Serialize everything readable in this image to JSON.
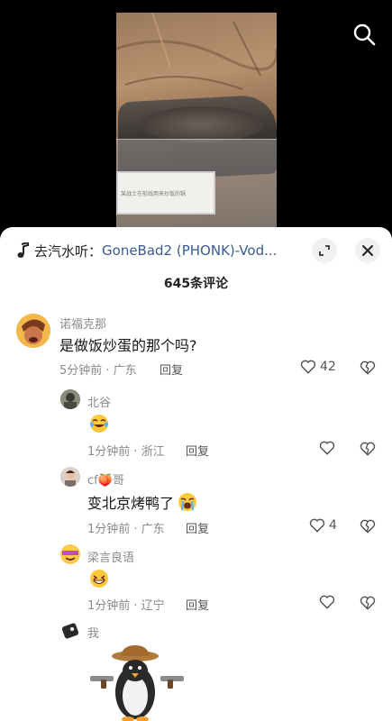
{
  "sheet": {
    "music_prefix": "去汽水听：",
    "music_title": "GoneBad2 (PHONK)-Vod...",
    "comment_count": "645条评论"
  },
  "placard_text": "某战士在前线用来炒饭的锅",
  "comments": [
    {
      "username": "诺福克那",
      "text": "是做饭炒蛋的那个吗?",
      "meta": "5分钟前 · 广东",
      "reply_label": "回复",
      "likes": "42"
    },
    {
      "username": "北谷",
      "text": "",
      "meta": "1分钟前 · 浙江",
      "reply_label": "回复",
      "likes": ""
    },
    {
      "username": "cf🍑哥",
      "text": "变北京烤鸭了",
      "meta": "1分钟前 · 广东",
      "reply_label": "回复",
      "likes": "4"
    },
    {
      "username": "梁言良语",
      "text": "",
      "meta": "1分钟前 · 辽宁",
      "reply_label": "回复",
      "likes": ""
    },
    {
      "username": "我",
      "text": "",
      "meta": "",
      "reply_label": "",
      "likes": ""
    }
  ],
  "icons": [
    "search-icon",
    "music-note-icon",
    "expand-icon",
    "close-icon",
    "heart-icon",
    "broken-heart-icon"
  ],
  "colors": {
    "link": "#3a5b93",
    "meta": "#8a8a8e",
    "sheet": "#ffffff"
  }
}
